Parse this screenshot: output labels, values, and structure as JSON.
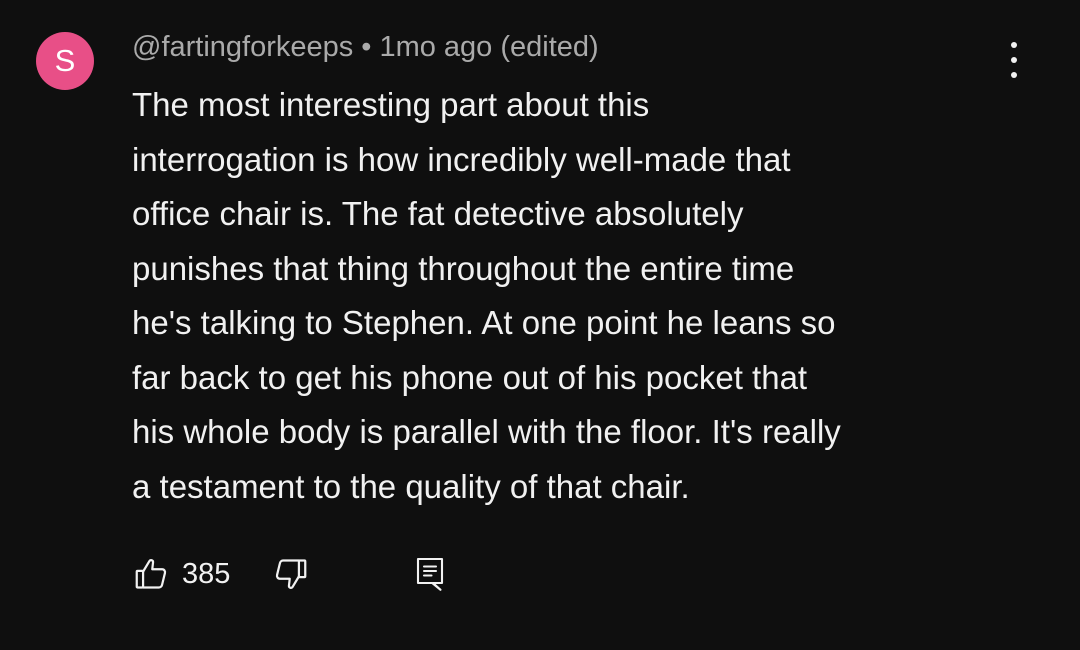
{
  "comment": {
    "avatar_letter": "S",
    "avatar_color": "#e84f87",
    "author": "@fartingforkeeps",
    "separator": "•",
    "timestamp": "1mo ago (edited)",
    "lines": [
      "The most interesting part about this",
      "interrogation is how incredibly well-made that",
      "office chair is. The fat detective absolutely",
      "punishes that thing throughout the entire time",
      "he's talking to Stephen. At one point he leans so",
      "far back to get his phone out of his pocket that",
      "his whole body is parallel with the floor. It's really",
      "a testament to the quality of that chair."
    ],
    "like_count": "385",
    "icons": {
      "menu": "more-vertical-icon",
      "like": "thumbs-up-icon",
      "dislike": "thumbs-down-icon",
      "reply": "reply-comment-icon"
    }
  },
  "colors": {
    "background": "#0f0f0f",
    "text_primary": "#f1f1f1",
    "text_secondary": "#aaaaaa"
  }
}
